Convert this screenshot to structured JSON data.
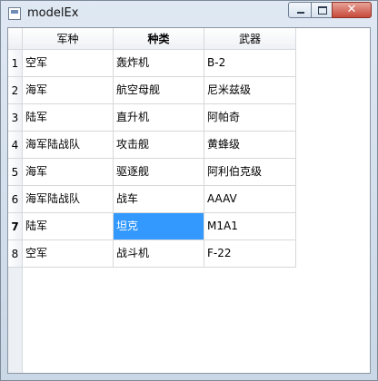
{
  "window": {
    "title": "modelEx",
    "close_glyph": "✕"
  },
  "table": {
    "columns": [
      "军种",
      "种类",
      "武器"
    ],
    "row_numbers": [
      "1",
      "2",
      "3",
      "4",
      "5",
      "6",
      "7",
      "8"
    ],
    "rows": [
      [
        "空军",
        "轰炸机",
        "B-2"
      ],
      [
        "海军",
        "航空母舰",
        "尼米兹级"
      ],
      [
        "陆军",
        "直升机",
        "阿帕奇"
      ],
      [
        "海军陆战队",
        "攻击舰",
        "黄蜂级"
      ],
      [
        "海军",
        "驱逐舰",
        "阿利伯克级"
      ],
      [
        "海军陆战队",
        "战车",
        "AAAV"
      ],
      [
        "陆军",
        "坦克",
        "M1A1"
      ],
      [
        "空军",
        "战斗机",
        "F-22"
      ]
    ],
    "selected": {
      "row": 7,
      "column": "种类"
    }
  },
  "colors": {
    "selection": "#3399ff",
    "close_button": "#c6493a"
  }
}
